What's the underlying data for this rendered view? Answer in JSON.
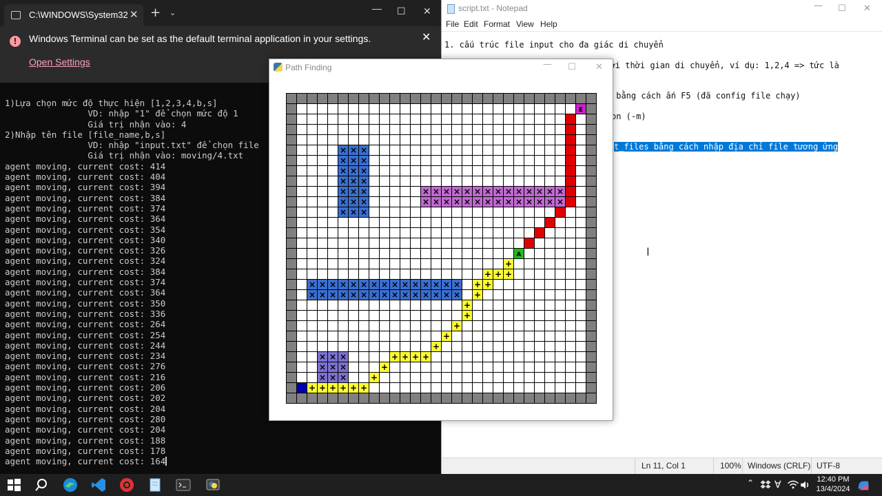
{
  "terminal": {
    "tab_title": "C:\\WINDOWS\\System32",
    "tab_close": "✕",
    "new_tab": "+",
    "dropdown": "⌄",
    "min": "—",
    "max": "☐",
    "close": "✕",
    "info_text": "Windows Terminal can be set as the default terminal application in your settings.",
    "info_link": "Open Settings",
    "info_icon": "!",
    "info_close": "✕",
    "output_lines": [
      "1)Lựa chọn mức độ thực hiện [1,2,3,4,b,s]",
      "                VD: nhập \"1\" để chọn mức độ 1",
      "                Giá trị nhận vào: 4",
      "2)Nhập tên file [file_name,b,s]",
      "                VD: nhập \"input.txt\" để chọn file",
      "                Giá trị nhận vào: moving/4.txt",
      "agent moving, current cost: 414",
      "agent moving, current cost: 404",
      "agent moving, current cost: 394",
      "agent moving, current cost: 384",
      "agent moving, current cost: 374",
      "agent moving, current cost: 364",
      "agent moving, current cost: 354",
      "agent moving, current cost: 340",
      "agent moving, current cost: 326",
      "agent moving, current cost: 324",
      "agent moving, current cost: 384",
      "agent moving, current cost: 374",
      "agent moving, current cost: 364",
      "agent moving, current cost: 350",
      "agent moving, current cost: 336",
      "agent moving, current cost: 264",
      "agent moving, current cost: 254",
      "agent moving, current cost: 244",
      "agent moving, current cost: 234",
      "agent moving, current cost: 276",
      "agent moving, current cost: 216",
      "agent moving, current cost: 206",
      "agent moving, current cost: 202",
      "agent moving, current cost: 204",
      "agent moving, current cost: 280",
      "agent moving, current cost: 204",
      "agent moving, current cost: 188",
      "agent moving, current cost: 178",
      "agent moving, current cost: 164"
    ]
  },
  "notepad": {
    "title": "script.txt - Notepad",
    "min": "—",
    "max": "☐",
    "close": "✕",
    "menu": [
      "File",
      "Edit",
      "Format",
      "View",
      "Help"
    ],
    "lines": [
      {
        "text": "1. cấu trúc file input cho đa giác di chuyển",
        "selected": false
      },
      {
        "text": "n kèm với thời gian di chuyển, ví dụ: 1,2,4 => tức là",
        "selected": false
      },
      {
        "text": " bằng cách ấn F5 (đã config file chạy)",
        "selected": false
      },
      {
        "text": "on (-m)",
        "selected": false
      },
      {
        "text": "t_files bằng cách nhập địa chỉ file tương ứng",
        "selected": true
      }
    ],
    "cursor_glyph": "I",
    "status": {
      "position": "Ln 11, Col 1",
      "zoom": "100%",
      "line_ending": "Windows (CRLF)",
      "encoding": "UTF-8"
    }
  },
  "pathfinding": {
    "title": "Path Finding",
    "min": "—",
    "max": "☐",
    "close": "✕",
    "grid": {
      "cols": 30,
      "rows": 30,
      "colors": {
        "border": "#808080",
        "empty": "#ffffff",
        "obstacle_blue": "#3a6fd1",
        "obstacle_purple": "#c069d1",
        "obstacle_violet": "#7c72d1",
        "path": "#ffff33",
        "trail": "#e00000",
        "start": "#0000aa",
        "agent": "#22bb22",
        "goal": "#cc22cc",
        "grid_line": "#000000"
      },
      "blue_cells": [
        [
          5,
          5
        ],
        [
          6,
          5
        ],
        [
          7,
          5
        ],
        [
          5,
          6
        ],
        [
          6,
          6
        ],
        [
          7,
          6
        ],
        [
          5,
          7
        ],
        [
          6,
          7
        ],
        [
          7,
          7
        ],
        [
          5,
          8
        ],
        [
          6,
          8
        ],
        [
          7,
          8
        ],
        [
          5,
          9
        ],
        [
          6,
          9
        ],
        [
          7,
          9
        ],
        [
          5,
          10
        ],
        [
          6,
          10
        ],
        [
          7,
          10
        ],
        [
          5,
          11
        ],
        [
          6,
          11
        ],
        [
          7,
          11
        ],
        [
          2,
          18
        ],
        [
          3,
          18
        ],
        [
          4,
          18
        ],
        [
          5,
          18
        ],
        [
          6,
          18
        ],
        [
          7,
          18
        ],
        [
          8,
          18
        ],
        [
          9,
          18
        ],
        [
          10,
          18
        ],
        [
          11,
          18
        ],
        [
          12,
          18
        ],
        [
          13,
          18
        ],
        [
          14,
          18
        ],
        [
          15,
          18
        ],
        [
          16,
          18
        ],
        [
          2,
          19
        ],
        [
          3,
          19
        ],
        [
          4,
          19
        ],
        [
          5,
          19
        ],
        [
          6,
          19
        ],
        [
          7,
          19
        ],
        [
          8,
          19
        ],
        [
          9,
          19
        ],
        [
          10,
          19
        ],
        [
          11,
          19
        ],
        [
          12,
          19
        ],
        [
          13,
          19
        ],
        [
          14,
          19
        ],
        [
          15,
          19
        ],
        [
          16,
          19
        ]
      ],
      "purple_cells": [
        [
          13,
          9
        ],
        [
          14,
          9
        ],
        [
          15,
          9
        ],
        [
          16,
          9
        ],
        [
          17,
          9
        ],
        [
          18,
          9
        ],
        [
          19,
          9
        ],
        [
          20,
          9
        ],
        [
          21,
          9
        ],
        [
          22,
          9
        ],
        [
          23,
          9
        ],
        [
          24,
          9
        ],
        [
          25,
          9
        ],
        [
          26,
          9
        ],
        [
          13,
          10
        ],
        [
          14,
          10
        ],
        [
          15,
          10
        ],
        [
          16,
          10
        ],
        [
          17,
          10
        ],
        [
          18,
          10
        ],
        [
          19,
          10
        ],
        [
          20,
          10
        ],
        [
          21,
          10
        ],
        [
          22,
          10
        ],
        [
          23,
          10
        ],
        [
          24,
          10
        ],
        [
          25,
          10
        ],
        [
          26,
          10
        ]
      ],
      "violet_cells": [
        [
          3,
          25
        ],
        [
          4,
          25
        ],
        [
          5,
          25
        ],
        [
          3,
          26
        ],
        [
          4,
          26
        ],
        [
          5,
          26
        ],
        [
          3,
          27
        ],
        [
          4,
          27
        ],
        [
          5,
          27
        ]
      ],
      "path_cells": [
        [
          2,
          28
        ],
        [
          3,
          28
        ],
        [
          4,
          28
        ],
        [
          5,
          28
        ],
        [
          6,
          28
        ],
        [
          7,
          28
        ],
        [
          8,
          27
        ],
        [
          9,
          26
        ],
        [
          10,
          25
        ],
        [
          11,
          25
        ],
        [
          12,
          25
        ],
        [
          13,
          25
        ],
        [
          14,
          24
        ],
        [
          15,
          23
        ],
        [
          16,
          22
        ],
        [
          17,
          21
        ],
        [
          17,
          20
        ],
        [
          18,
          19
        ],
        [
          18,
          18
        ],
        [
          19,
          18
        ],
        [
          19,
          17
        ],
        [
          20,
          17
        ],
        [
          21,
          17
        ],
        [
          21,
          16
        ]
      ],
      "trail_cells": [
        [
          27,
          2
        ],
        [
          27,
          3
        ],
        [
          27,
          4
        ],
        [
          27,
          5
        ],
        [
          27,
          6
        ],
        [
          27,
          7
        ],
        [
          27,
          8
        ],
        [
          27,
          9
        ],
        [
          27,
          10
        ],
        [
          26,
          11
        ],
        [
          25,
          12
        ],
        [
          24,
          13
        ],
        [
          23,
          14
        ]
      ],
      "start_cell": [
        1,
        28
      ],
      "agent_cell": [
        22,
        15
      ],
      "goal_cell": [
        28,
        1
      ],
      "obstacle_mark": "×",
      "path_mark": "+",
      "agent_label": "A",
      "goal_label": "E"
    }
  },
  "taskbar": {
    "time": "12:40 PM",
    "date": "13/4/2024"
  }
}
